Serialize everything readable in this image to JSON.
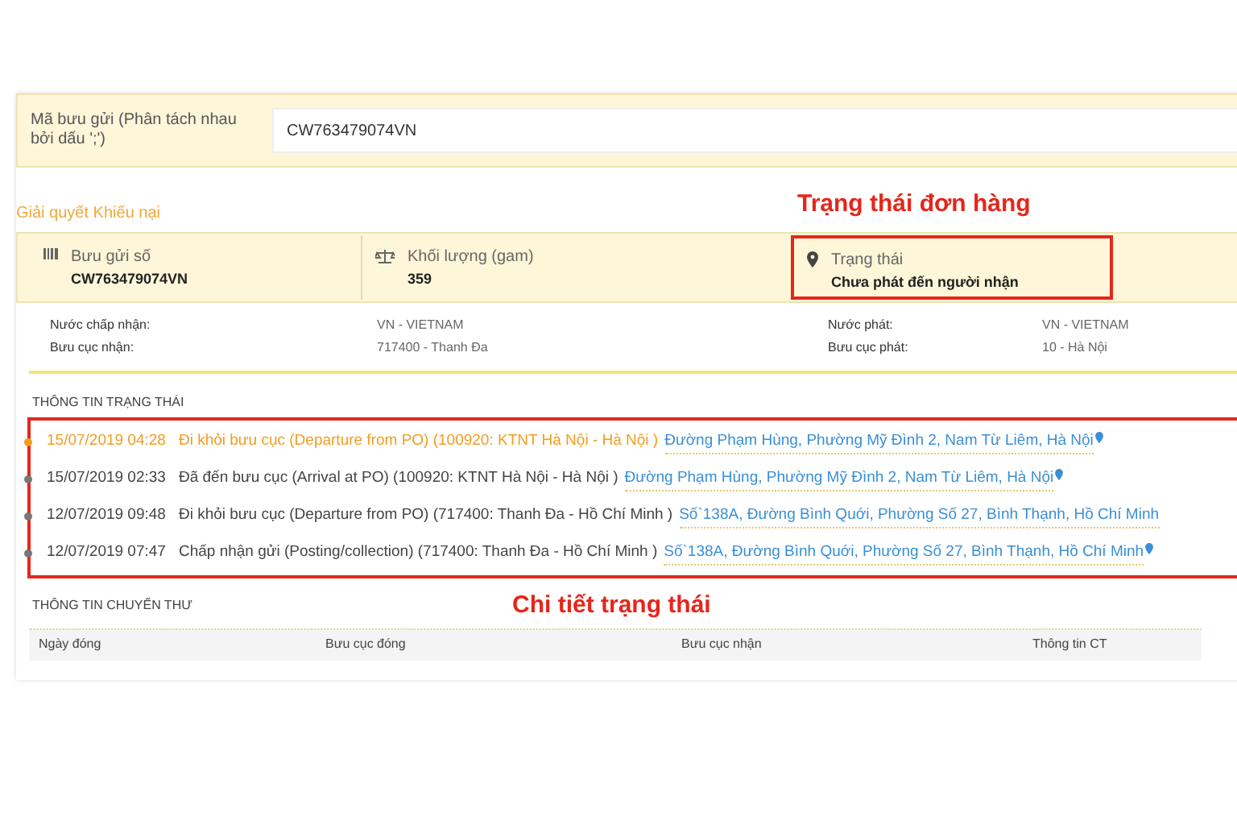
{
  "search": {
    "label": "Mã bưu gửi (Phân tách nhau bởi dấu ';')",
    "value": "CW763479074VN"
  },
  "complaint_link": "Giải quyết Khiếu nại",
  "annotations": {
    "status": "Trạng thái đơn hàng",
    "details": "Chi tiết trạng thái"
  },
  "summary": [
    {
      "kind": "barcode",
      "label": "Bưu gửi số",
      "value": "CW763479074VN",
      "highlighted": false
    },
    {
      "kind": "scale",
      "label": "Khối lượng (gam)",
      "value": "359",
      "highlighted": false
    },
    {
      "kind": "pin",
      "label": "Trạng thái",
      "value": "Chưa phát đến người nhận",
      "highlighted": true
    }
  ],
  "details": [
    {
      "label": "Nước chấp nhận:",
      "value": "VN - VIETNAM"
    },
    {
      "label": "Nước phát:",
      "value": "VN - VIETNAM"
    },
    {
      "label": "Bưu cục nhận:",
      "value": "717400 - Thanh Đa"
    },
    {
      "label": "Bưu cục phát:",
      "value": "10 - Hà Nội"
    }
  ],
  "status_heading": "THÔNG TIN TRẠNG THÁI",
  "events": [
    {
      "time": "15/07/2019 04:28",
      "description": "Đi khỏi bưu cục (Departure from PO) (100920: KTNT Hà Nội - Hà Nội )",
      "address": "Đường Phạm Hùng, Phường Mỹ Đình 2, Nam Từ Liêm, Hà Nội",
      "current": true,
      "pin": true
    },
    {
      "time": "15/07/2019 02:33",
      "description": "Đã đến bưu cục (Arrival at PO) (100920: KTNT Hà Nội - Hà Nội )",
      "address": "Đường Phạm Hùng, Phường Mỹ Đình 2, Nam Từ Liêm, Hà Nội",
      "current": false,
      "pin": true
    },
    {
      "time": "12/07/2019 09:48",
      "description": "Đi khỏi bưu cục (Departure from PO) (717400: Thanh Đa - Hồ Chí Minh )",
      "address": "Số`138A, Đường Bình Quới, Phường Số 27, Bình Thạnh, Hồ Chí Minh",
      "current": false,
      "pin": false
    },
    {
      "time": "12/07/2019 07:47",
      "description": "Chấp nhận gửi (Posting/collection) (717400: Thanh Đa - Hồ Chí Minh )",
      "address": "Số`138A, Đường Bình Quới, Phường Số 27, Bình Thạnh, Hồ Chí Minh",
      "current": false,
      "pin": true
    }
  ],
  "mail_heading": "THÔNG TIN CHUYỂN THƯ",
  "mail_table": {
    "columns": [
      "Ngày đóng",
      "Bưu cục đóng",
      "Bưu cục nhận",
      "Thông tin CT"
    ]
  }
}
